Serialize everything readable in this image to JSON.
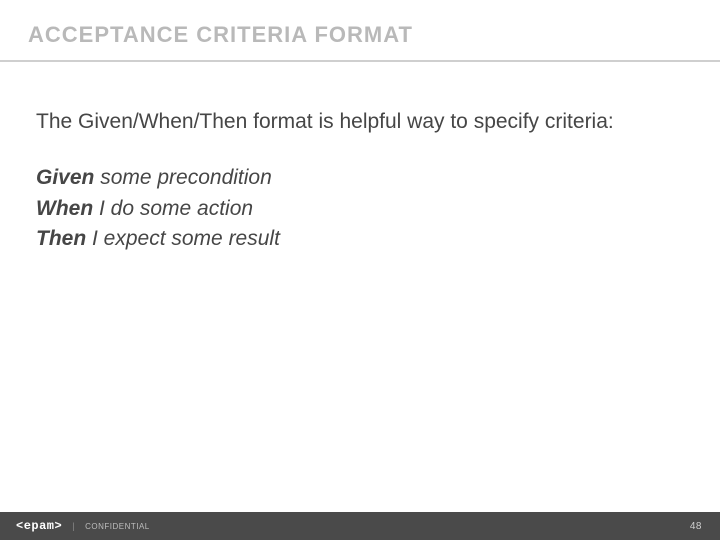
{
  "header": {
    "title": "ACCEPTANCE CRITERIA FORMAT"
  },
  "content": {
    "intro": "The Given/When/Then format is helpful way to specify criteria:",
    "lines": {
      "given_kw": "Given",
      "given_rest": " some precondition",
      "when_kw": "When",
      "when_rest": " I do some action",
      "then_kw": "Then",
      "then_rest": " I expect some result"
    }
  },
  "footer": {
    "logo": "<epam>",
    "separator": "|",
    "confidential": "CONFIDENTIAL",
    "page_number": "48"
  }
}
